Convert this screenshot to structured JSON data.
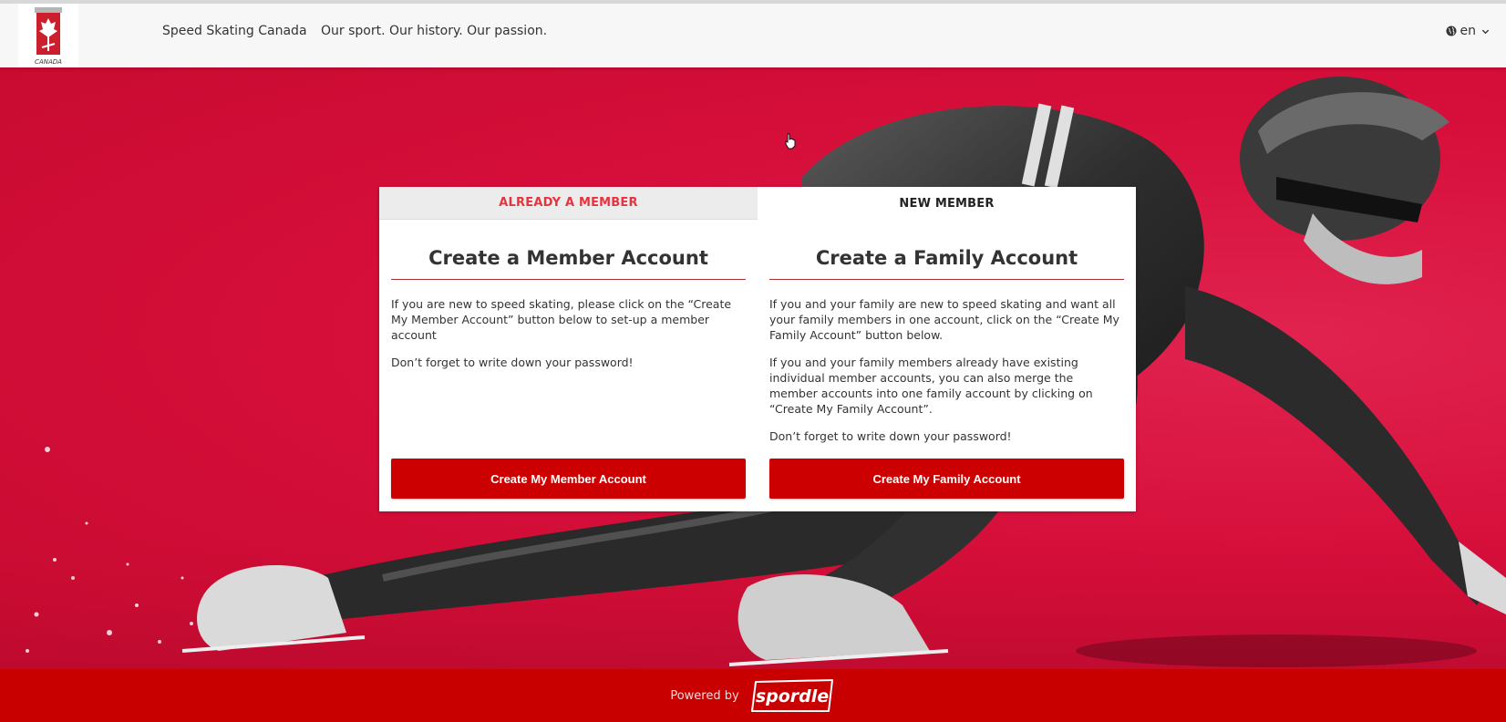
{
  "header": {
    "brand": "Speed Skating Canada",
    "tagline": "Our sport. Our history. Our passion.",
    "logo_text": "CANADA",
    "language": "en"
  },
  "tabs": {
    "member": "ALREADY A MEMBER",
    "new": "NEW MEMBER"
  },
  "member_account": {
    "title": "Create a Member Account",
    "para1": "If you are new to speed skating, please click on the “Create My Member Account” button below to set-up a member account",
    "para2": "Don’t forget to write down your password!",
    "button": "Create My Member Account"
  },
  "family_account": {
    "title": "Create a Family Account",
    "para1": "If you and your family are new to speed skating and want all your family members in one account, click on the “Create My Family Account” button below.",
    "para2": "If you and your family members already have existing individual member accounts, you can also merge the member accounts into one family account by clicking on “Create My Family Account”.",
    "para3": "Don’t forget to write down your password!",
    "button": "Create My Family Account"
  },
  "footer": {
    "powered_by": "Powered by",
    "brand": "spordle"
  },
  "colors": {
    "primary_red": "#cc0000",
    "hero_red": "#d70f3b",
    "tab_active_text": "#e8333f"
  }
}
